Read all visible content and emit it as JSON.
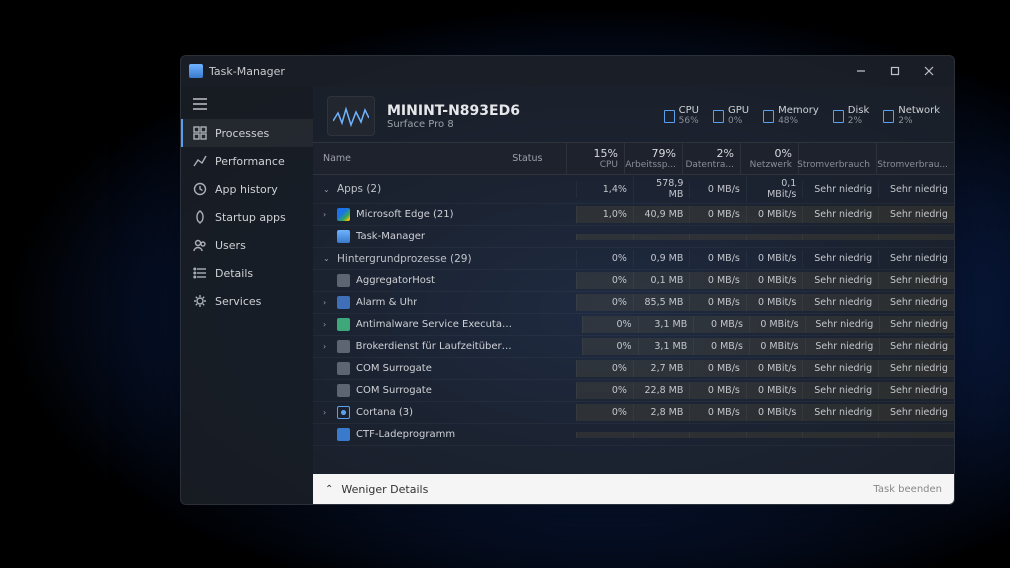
{
  "window": {
    "title": "Task-Manager"
  },
  "controls": {
    "minimize": "min",
    "maximize": "max",
    "close": "close"
  },
  "sidebar": {
    "items": [
      {
        "label": "Processes",
        "icon": "grid"
      },
      {
        "label": "Performance",
        "icon": "chart"
      },
      {
        "label": "App history",
        "icon": "clock"
      },
      {
        "label": "Startup apps",
        "icon": "rocket"
      },
      {
        "label": "Users",
        "icon": "users"
      },
      {
        "label": "Details",
        "icon": "list"
      },
      {
        "label": "Services",
        "icon": "gear"
      }
    ],
    "activeIndex": 0
  },
  "host": {
    "name": "MININT-N893ED6",
    "model": "Surface Pro 8"
  },
  "headerStats": [
    {
      "name": "CPU",
      "value": "56%"
    },
    {
      "name": "GPU",
      "value": "0%"
    },
    {
      "name": "Memory",
      "value": "48%"
    },
    {
      "name": "Disk",
      "value": "2%"
    },
    {
      "name": "Network",
      "value": "2%"
    }
  ],
  "columns": {
    "name": "Name",
    "status": "Status",
    "metrics": [
      {
        "pct": "15%",
        "label": "CPU"
      },
      {
        "pct": "79%",
        "label": "Arbeitssp..."
      },
      {
        "pct": "2%",
        "label": "Datentra..."
      },
      {
        "pct": "0%",
        "label": "Netzwerk"
      },
      {
        "pct": "",
        "label": "Stromverbrauch"
      },
      {
        "pct": "",
        "label": "Stromverbrau..."
      }
    ]
  },
  "groups": [
    {
      "title": "Apps (2)"
    },
    {
      "title": "Hintergrundprozesse (29)"
    }
  ],
  "rows": [
    {
      "type": "group",
      "titleIdx": 0,
      "cells": [
        "1,4%",
        "578,9 MB",
        "0 MB/s",
        "0,1 MBit/s",
        "Sehr niedrig",
        "Sehr niedrig"
      ]
    },
    {
      "type": "proc",
      "name": "Microsoft Edge (21)",
      "icon": "c-edge",
      "expandable": true,
      "cells": [
        "1,0%",
        "40,9 MB",
        "0 MB/s",
        "0 MBit/s",
        "Sehr niedrig",
        "Sehr niedrig"
      ]
    },
    {
      "type": "proc",
      "name": "Task-Manager",
      "icon": "c-tm",
      "expandable": false,
      "cells": [
        "",
        "",
        "",
        "",
        "",
        ""
      ]
    },
    {
      "type": "group",
      "titleIdx": 1,
      "cells": [
        "0%",
        "0,9 MB",
        "0 MB/s",
        "0 MBit/s",
        "Sehr niedrig",
        "Sehr niedrig"
      ]
    },
    {
      "type": "proc",
      "name": "AggregatorHost",
      "icon": "c-gear",
      "cells": [
        "0%",
        "0,1 MB",
        "0 MB/s",
        "0 MBit/s",
        "Sehr niedrig",
        "Sehr niedrig"
      ]
    },
    {
      "type": "proc",
      "name": "Alarm & Uhr",
      "icon": "c-blue",
      "expandable": true,
      "cells": [
        "0%",
        "85,5 MB",
        "0 MB/s",
        "0 MBit/s",
        "Sehr niedrig",
        "Sehr niedrig"
      ]
    },
    {
      "type": "proc",
      "name": "Antimalware Service Executabl...",
      "icon": "c-green",
      "expandable": true,
      "cells": [
        "0%",
        "3,1 MB",
        "0 MB/s",
        "0 MBit/s",
        "Sehr niedrig",
        "Sehr niedrig"
      ]
    },
    {
      "type": "proc",
      "name": "Brokerdienst für Laufzeitüberwa...",
      "icon": "c-gear",
      "expandable": true,
      "cells": [
        "0%",
        "3,1 MB",
        "0 MB/s",
        "0 MBit/s",
        "Sehr niedrig",
        "Sehr niedrig"
      ]
    },
    {
      "type": "proc",
      "name": "COM Surrogate",
      "icon": "c-gear",
      "cells": [
        "0%",
        "2,7 MB",
        "0 MB/s",
        "0 MBit/s",
        "Sehr niedrig",
        "Sehr niedrig"
      ]
    },
    {
      "type": "proc",
      "name": "COM Surrogate",
      "icon": "c-gear",
      "cells": [
        "0%",
        "22,8 MB",
        "0 MB/s",
        "0 MBit/s",
        "Sehr niedrig",
        "Sehr niedrig"
      ]
    },
    {
      "type": "proc",
      "name": "Cortana (3)",
      "icon": "c-cortana",
      "expandable": true,
      "cells": [
        "0%",
        "2,8 MB",
        "0 MB/s",
        "0 MBit/s",
        "Sehr niedrig",
        "Sehr niedrig"
      ]
    },
    {
      "type": "proc",
      "name": "CTF-Ladeprogramm",
      "icon": "c-win",
      "cells": [
        "",
        "",
        "",
        "",
        "",
        ""
      ]
    }
  ],
  "footer": {
    "fewer": "Weniger Details",
    "endTask": "Task beenden"
  }
}
